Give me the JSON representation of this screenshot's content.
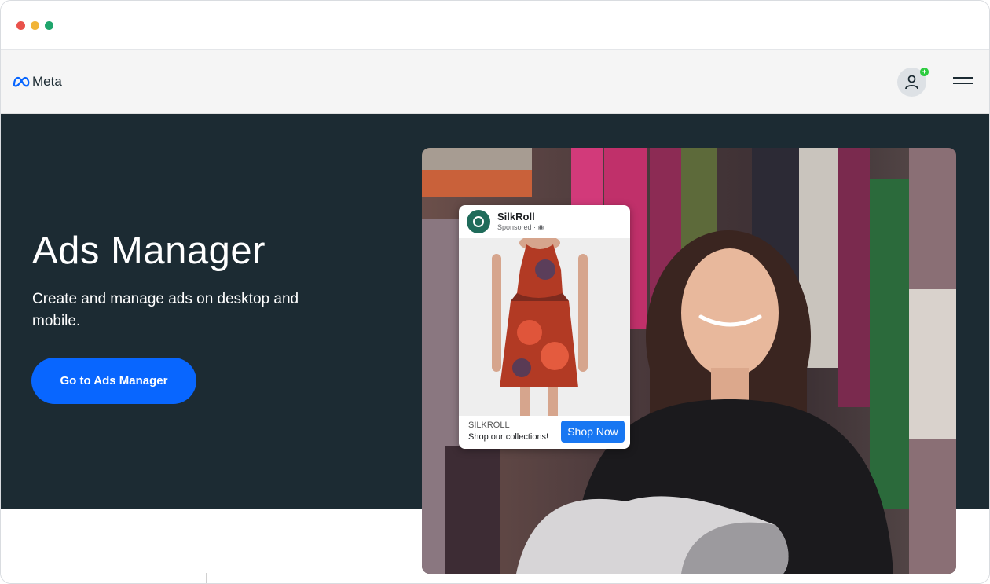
{
  "window": {
    "controls": [
      "close",
      "minimize",
      "maximize"
    ]
  },
  "nav": {
    "logo_text": "Meta",
    "logo_icon": "meta-infinity-icon",
    "account_icon": "person-icon",
    "account_badge": "+",
    "menu_icon": "hamburger-menu-icon"
  },
  "hero": {
    "title": "Ads Manager",
    "subtitle": "Create and manage ads on desktop and mobile.",
    "cta_label": "Go to Ads Manager"
  },
  "ad_preview": {
    "brand": "SilkRoll",
    "sponsored": "Sponsored · ",
    "footer_brand": "SILKROLL",
    "footer_text": "Shop our collections!",
    "button_label": "Shop Now"
  },
  "colors": {
    "hero_background": "#1c2b33",
    "cta": "#0866ff",
    "shop_button": "#1877f2",
    "badge": "#2ecc40"
  }
}
